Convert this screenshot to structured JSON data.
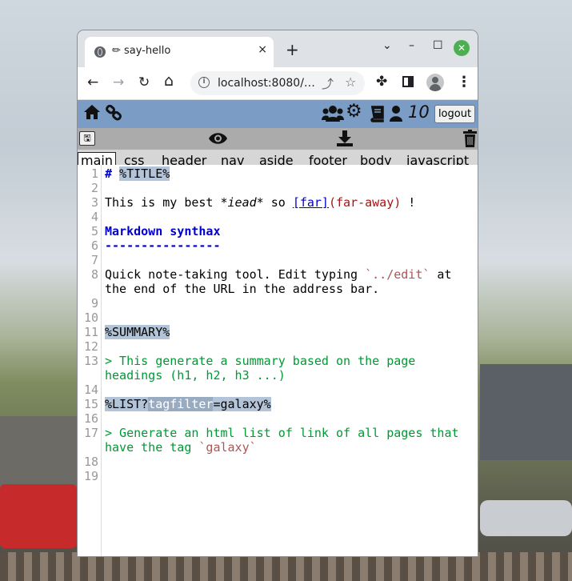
{
  "browser": {
    "tab_title": "✏ say-hello",
    "tab_close": "×",
    "new_tab": "+",
    "window_controls": [
      "⌄",
      "–",
      "☐",
      "✕"
    ],
    "url": "localhost:8080/…",
    "nav": {
      "back": "←",
      "forward": "→",
      "reload": "↻",
      "home": "⌂"
    }
  },
  "app": {
    "user_count": "10",
    "logout_label": "logout",
    "save_icon": "🖫",
    "icons": [
      "home-icon",
      "link-icon",
      "users-icon",
      "gear-icon",
      "book-icon",
      "user-icon",
      "eye-icon",
      "download-icon",
      "trash-icon"
    ]
  },
  "file_tabs": [
    {
      "label": "main",
      "active": true
    },
    {
      "label": "css"
    },
    {
      "label": "header"
    },
    {
      "label": "nav"
    },
    {
      "label": "aside"
    },
    {
      "label": "footer"
    },
    {
      "label": "body"
    },
    {
      "label": "javascript"
    }
  ],
  "editor": {
    "line_numbers": [
      "1",
      "2",
      "3",
      "4",
      "5",
      "6",
      "7",
      "8",
      "",
      "9",
      "10",
      "11",
      "12",
      "13",
      "",
      "14",
      "15",
      "16",
      "17",
      "",
      "18",
      "19"
    ],
    "lines": {
      "l1_hash": "#",
      "l1_title": "%TITLE%",
      "l3_a": "This is my best ",
      "l3_b": "*iead*",
      "l3_c": " so ",
      "l3_d": "[far]",
      "l3_e": "(far-away)",
      "l3_f": " !",
      "l5": "Markdown synthax",
      "l6": "----------------",
      "l8a_a": "Quick note-taking tool. Edit typing ",
      "l8a_b": "`../edit`",
      "l8a_c": " at",
      "l8b": "the end of the URL in the address bar.",
      "l11": "%SUMMARY%",
      "l13a": "> This generate a summary based on the page",
      "l13b": "headings (h1, h2, h3 ...)",
      "l15_a": "%LIST?",
      "l15_b": "tagfilter",
      "l15_c": "=galaxy%",
      "l17a": "> Generate an html list of link of all pages that",
      "l17b_a": "have the tag ",
      "l17b_b": "`galaxy`"
    }
  }
}
